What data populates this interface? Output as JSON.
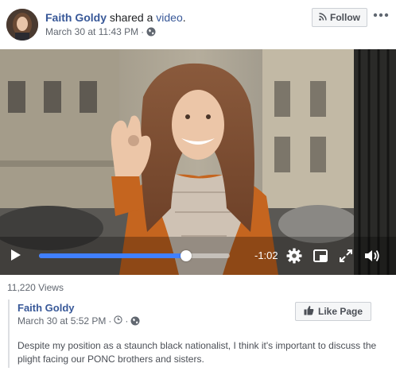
{
  "post": {
    "author": "Faith Goldy",
    "action_text": " shared a ",
    "object_link": "video",
    "object_suffix": ".",
    "timestamp": "March 30 at 11:43 PM",
    "separator": " · ",
    "privacy_icon": "globe-icon",
    "follow_label": "Follow",
    "follow_icon": "rss-icon",
    "more_icon": "more-options-icon"
  },
  "video": {
    "time_remaining": "-1:02",
    "progress": 0.77,
    "icons": [
      "play-icon",
      "settings-gear-icon",
      "picture-in-picture-icon",
      "fullscreen-icon",
      "volume-icon"
    ],
    "accent_color": "#4080ff"
  },
  "stats": {
    "views": "11,220 Views"
  },
  "shared": {
    "author": "Faith Goldy",
    "timestamp": "March 30 at 5:52 PM",
    "separator": " · ",
    "clock_icon": "clock-icon",
    "privacy_icon": "globe-icon",
    "like_page_label": "Like Page",
    "like_icon": "thumbs-up-icon",
    "text": "Despite my position as a staunch black nationalist, I think it's important to discuss the plight facing our PONC brothers and sisters."
  },
  "colors": {
    "link": "#385898",
    "meta": "#616770",
    "button_bg": "#f5f6f7"
  }
}
